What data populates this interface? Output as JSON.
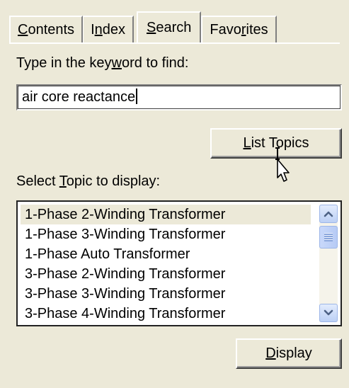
{
  "tabs": [
    {
      "pre": "",
      "key": "C",
      "post": "ontents"
    },
    {
      "pre": "I",
      "key": "n",
      "post": "dex"
    },
    {
      "pre": "",
      "key": "S",
      "post": "earch"
    },
    {
      "pre": "Favo",
      "key": "r",
      "post": "ites"
    }
  ],
  "keyword_label": {
    "pre": "Type in the key",
    "key": "w",
    "post": "ord to find:"
  },
  "search_value": "air core reactance",
  "list_topics_button": {
    "pre": "",
    "key": "L",
    "post": "ist Topics"
  },
  "select_label": {
    "pre": "Select ",
    "key": "T",
    "post": "opic to display:"
  },
  "topics": [
    "1-Phase 2-Winding Transformer",
    "1-Phase 3-Winding Transformer",
    "1-Phase Auto Transformer",
    "3-Phase 2-Winding Transformer",
    "3-Phase 3-Winding Transformer",
    "3-Phase 4-Winding Transformer"
  ],
  "display_button": {
    "pre": "",
    "key": "D",
    "post": "isplay"
  },
  "scrollbar": {
    "up_icon": "chevron-up-icon",
    "down_icon": "chevron-down-icon"
  },
  "colors": {
    "window_bg": "#ece9d8",
    "selected_row": "#ece9d8",
    "scroll_accent": "#4d6185"
  }
}
